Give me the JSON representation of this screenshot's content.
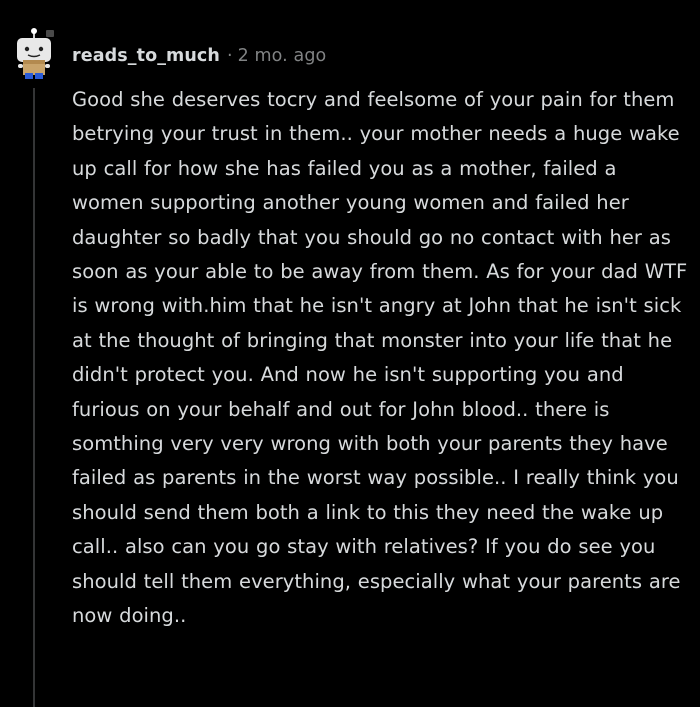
{
  "comment": {
    "author": "reads_to_much",
    "separator": "·",
    "timestamp": "2 mo. ago",
    "avatar_icon": "snoo-avatar-icon",
    "body": "Good she deserves tocry and feelsome of your pain for them betrying your trust in them.. your mother needs a huge wake up call for how she has failed you as a mother, failed a women supporting another young women and failed her daughter so badly that you should go no contact with her as soon as your able to be away from them. As for your dad WTF is wrong with.him that he isn't angry at John that he isn't sick at the thought of bringing that monster into your life that he didn't protect you. And now he isn't supporting you and furious on your behalf and out for John blood.. there is somthing very very wrong with both your parents they have failed as parents in the worst way possible.. I really think you should send them both a link to this they need the wake up call.. also can you go stay with relatives? If you do see you should tell them everything, especially what your parents are now doing.."
  },
  "colors": {
    "background": "#000000",
    "text": "#d7dadc",
    "meta": "#818384",
    "thread_line": "#343536"
  }
}
